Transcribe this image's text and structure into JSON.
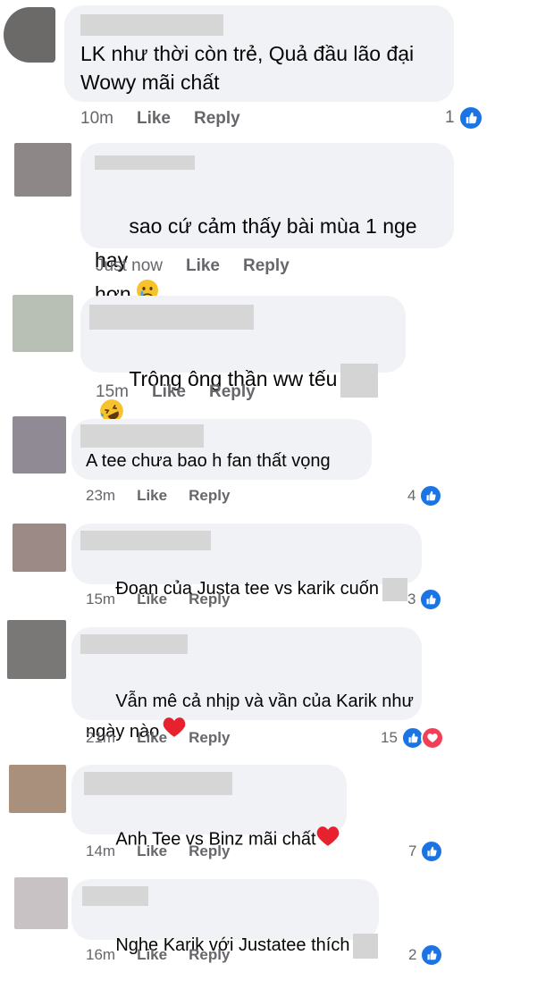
{
  "comments": [
    {
      "text": "LK như thời còn trẻ, Quả đầu lão đại\nWowy mãi chất",
      "time": "10m",
      "like": "Like",
      "reply": "Reply",
      "count": "1",
      "avatar_color": "#6b6a69"
    },
    {
      "text": "sao cứ cảm thấy bài mùa 1 nge hay\nhơn",
      "time": "Just now",
      "like": "Like",
      "reply": "Reply",
      "count": "",
      "avatar_color": "#8d8787",
      "emoji": "crying-face-icon"
    },
    {
      "text": "Trông ông thần ww tếu",
      "time": "15m",
      "like": "Like",
      "reply": "Reply",
      "count": "",
      "avatar_color": "#b8bfb4",
      "emoji": "rofl-face-icon"
    },
    {
      "text": "A tee chưa bao h fan thất vọng",
      "time": "23m",
      "like": "Like",
      "reply": "Reply",
      "count": "4",
      "avatar_color": "#8f8a94"
    },
    {
      "text": "Đoạn của Justa tee vs karik cuốn",
      "time": "15m",
      "like": "Like",
      "reply": "Reply",
      "count": "3",
      "avatar_color": "#9b8a85"
    },
    {
      "text": "Vẫn mê cả nhịp và vần của Karik như\nngày nào",
      "time": "21m",
      "like": "Like",
      "reply": "Reply",
      "count": "15",
      "avatar_color": "#7a7876",
      "emoji": "heart-icon"
    },
    {
      "text": "Anh Tee vs Binz mãi chất",
      "time": "14m",
      "like": "Like",
      "reply": "Reply",
      "count": "7",
      "avatar_color": "#a8907c",
      "emoji": "heart-icon"
    },
    {
      "text": "Nghe Karik với Justatee thích",
      "time": "16m",
      "like": "Like",
      "reply": "Reply",
      "count": "2",
      "avatar_color": "#c9c2c4"
    }
  ],
  "colors": {
    "like_blue": "#1b74e4",
    "heart_red": "#f33e58",
    "bubble": "#f0f2f5",
    "meta_gray": "#65676b"
  }
}
